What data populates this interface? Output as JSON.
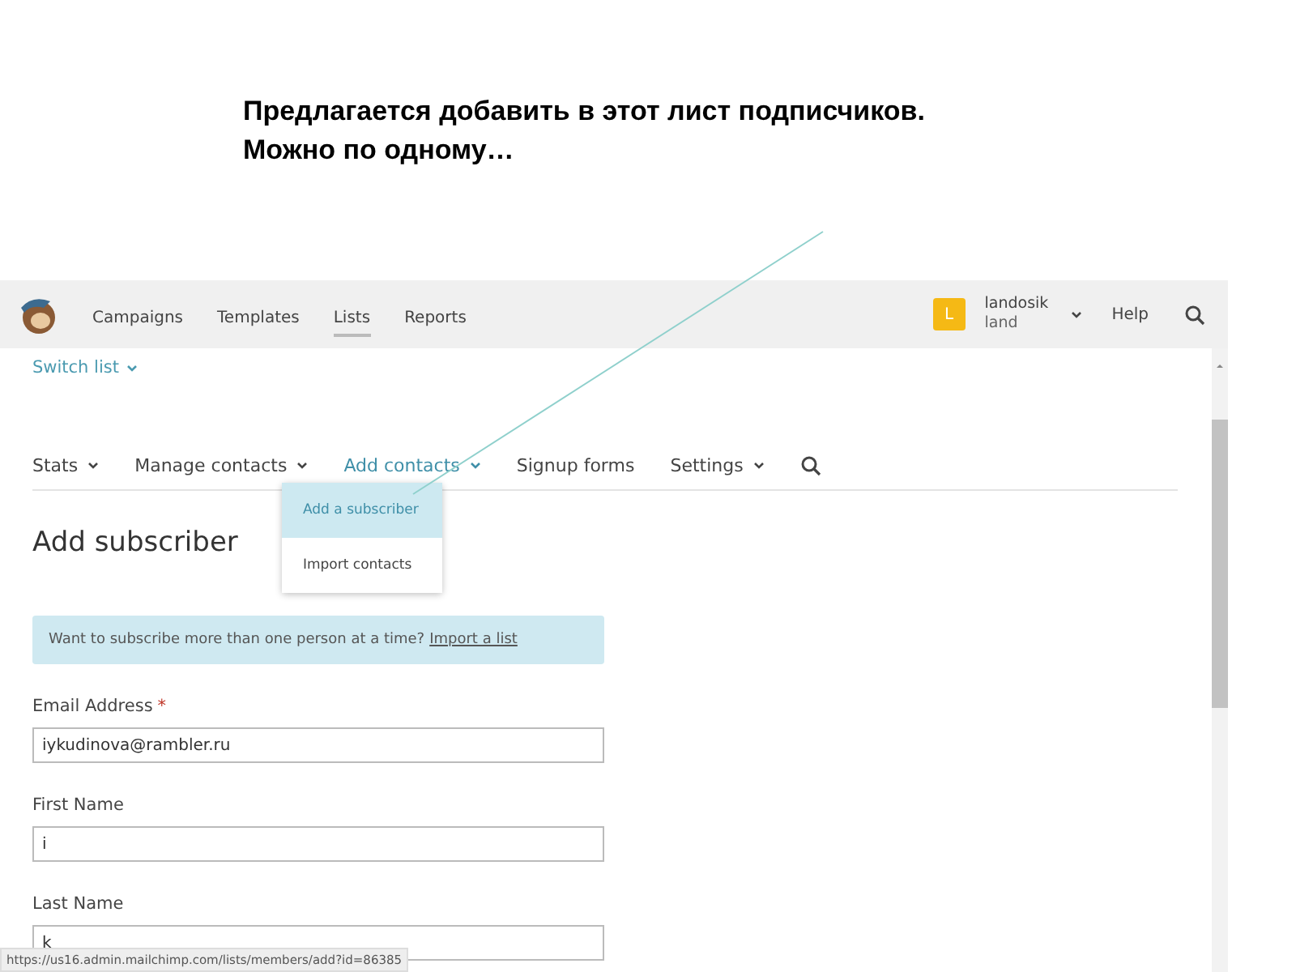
{
  "caption": [
    "Предлагается добавить в этот лист подписчиков.",
    "Можно по одному…"
  ],
  "topbar": {
    "nav": [
      {
        "label": "Campaigns",
        "selected": false
      },
      {
        "label": "Templates",
        "selected": false
      },
      {
        "label": "Lists",
        "selected": true
      },
      {
        "label": "Reports",
        "selected": false
      }
    ],
    "avatar": "L",
    "user": "landosik",
    "account": "land",
    "help": "Help"
  },
  "switch_list": "Switch list",
  "subnav": [
    {
      "label": "Stats",
      "selected": false,
      "dropdown": true
    },
    {
      "label": "Manage contacts",
      "selected": false,
      "dropdown": true
    },
    {
      "label": "Add contacts",
      "selected": true,
      "dropdown": true
    },
    {
      "label": "Signup forms",
      "selected": false,
      "dropdown": false
    },
    {
      "label": "Settings",
      "selected": false,
      "dropdown": true
    }
  ],
  "dropdown": [
    {
      "label": "Add a subscriber",
      "selected": true
    },
    {
      "label": "Import contacts",
      "selected": false
    }
  ],
  "heading": "Add subscriber",
  "notice": {
    "text": "Want to subscribe more than one person at a time?",
    "link": "Import a list"
  },
  "fields": [
    {
      "label": "Email Address",
      "required_mark": "*",
      "value": "iykudinova@rambler.ru"
    },
    {
      "label": "First Name",
      "value": "i"
    },
    {
      "label": "Last Name",
      "value": "k"
    }
  ],
  "status_url": "https://us16.admin.mailchimp.com/lists/members/add?id=86385"
}
